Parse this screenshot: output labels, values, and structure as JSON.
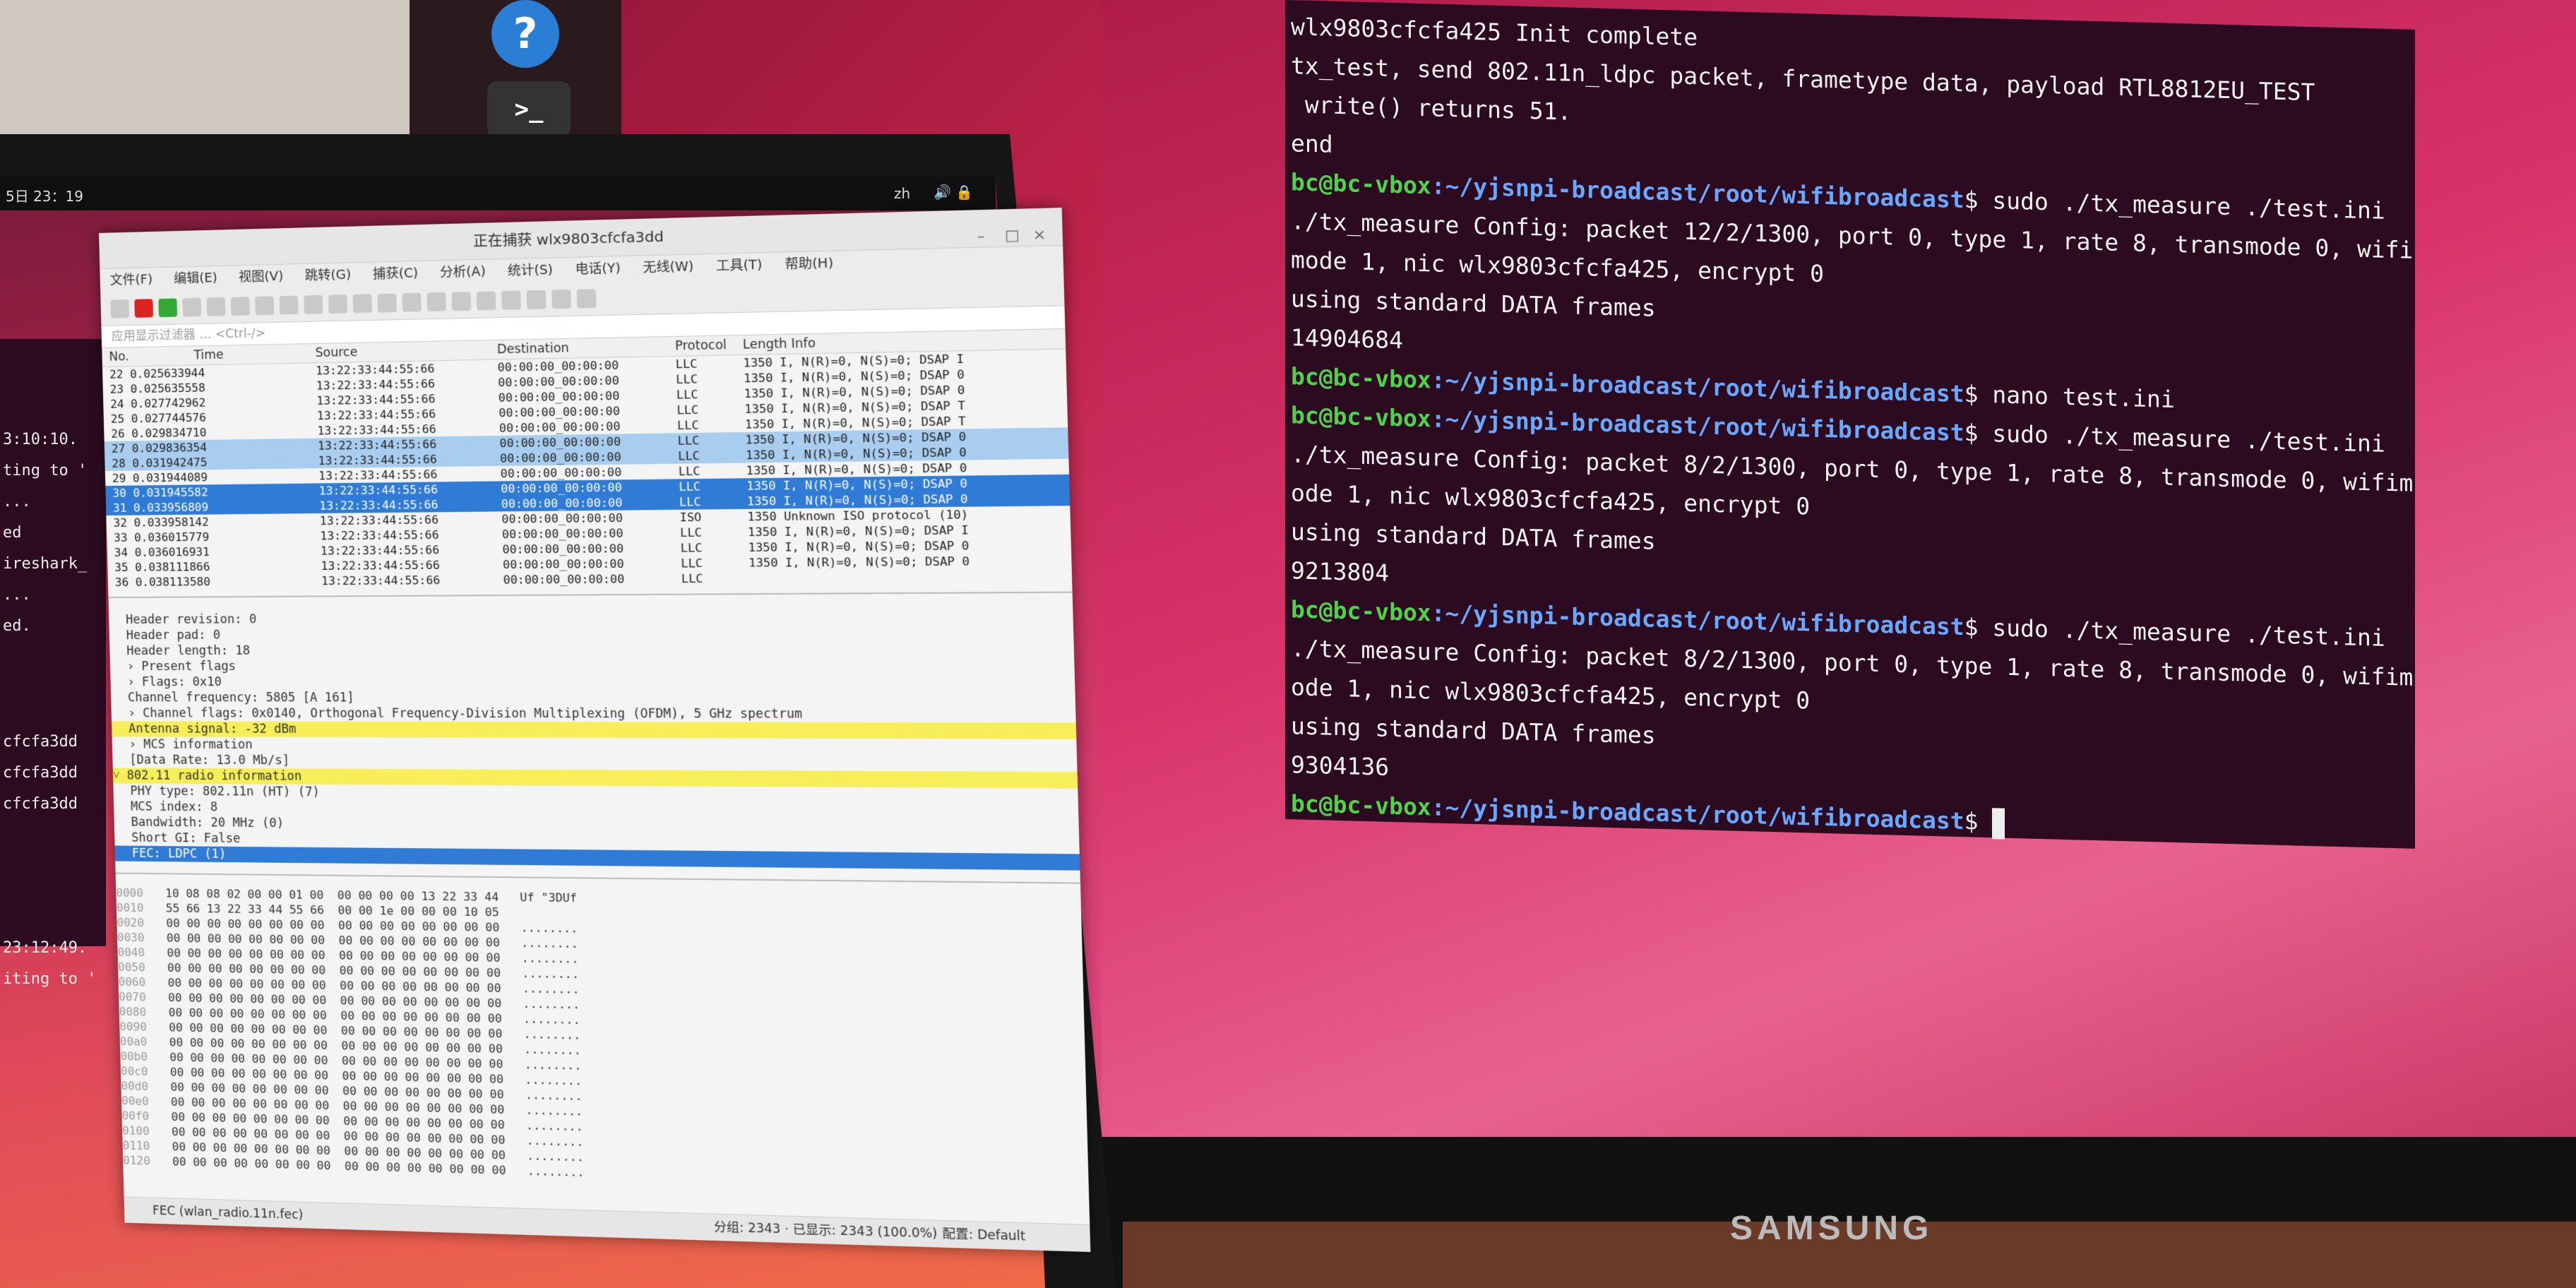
{
  "desktop": {
    "topbar_time": "5日 23：19",
    "topbar_lang": "zh",
    "topbar_indicators": "🔊 🔒"
  },
  "background_terminal": {
    "lines": [
      "3:10:10.",
      "ting to '",
      "...",
      "ed",
      "ireshark_",
      "...",
      "ed.",
      "cfcfa3dd",
      "cfcfa3dd",
      "cfcfa3dd",
      "23:12:49.",
      "iting to '"
    ]
  },
  "wireshark": {
    "title": "正在捕获 wlx9803cfcfa3dd",
    "menu": [
      "文件(F)",
      "编辑(E)",
      "视图(V)",
      "跳转(G)",
      "捕获(C)",
      "分析(A)",
      "统计(S)",
      "电话(Y)",
      "无线(W)",
      "工具(T)",
      "帮助(H)"
    ],
    "filter_placeholder": "应用显示过滤器 … <Ctrl-/>",
    "columns": [
      "No.",
      "Time",
      "Source",
      "Destination",
      "Protocol",
      "Length",
      "Info"
    ],
    "packets": [
      {
        "no": "22",
        "time": "0.025633944",
        "src": "13:22:33:44:55:66",
        "dst": "00:00:00_00:00:00",
        "proto": "LLC",
        "info": "1350 I, N(R)=0, N(S)=0; DSAP I"
      },
      {
        "no": "23",
        "time": "0.025635558",
        "src": "13:22:33:44:55:66",
        "dst": "00:00:00_00:00:00",
        "proto": "LLC",
        "info": "1350 I, N(R)=0, N(S)=0; DSAP 0"
      },
      {
        "no": "24",
        "time": "0.027742962",
        "src": "13:22:33:44:55:66",
        "dst": "00:00:00_00:00:00",
        "proto": "LLC",
        "info": "1350 I, N(R)=0, N(S)=0; DSAP 0"
      },
      {
        "no": "25",
        "time": "0.027744576",
        "src": "13:22:33:44:55:66",
        "dst": "00:00:00_00:00:00",
        "proto": "LLC",
        "info": "1350 I, N(R)=0, N(S)=0; DSAP T"
      },
      {
        "no": "26",
        "time": "0.029834710",
        "src": "13:22:33:44:55:66",
        "dst": "00:00:00_00:00:00",
        "proto": "LLC",
        "info": "1350 I, N(R)=0, N(S)=0; DSAP T"
      },
      {
        "no": "27",
        "time": "0.029836354",
        "src": "13:22:33:44:55:66",
        "dst": "00:00:00_00:00:00",
        "proto": "LLC",
        "info": "1350 I, N(R)=0, N(S)=0; DSAP 0"
      },
      {
        "no": "28",
        "time": "0.031942475",
        "src": "13:22:33:44:55:66",
        "dst": "00:00:00_00:00:00",
        "proto": "LLC",
        "info": "1350 I, N(R)=0, N(S)=0; DSAP 0"
      },
      {
        "no": "29",
        "time": "0.031944089",
        "src": "13:22:33:44:55:66",
        "dst": "00:00:00_00:00:00",
        "proto": "LLC",
        "info": "1350 I, N(R)=0, N(S)=0; DSAP 0"
      },
      {
        "no": "30",
        "time": "0.031945582",
        "src": "13:22:33:44:55:66",
        "dst": "00:00:00_00:00:00",
        "proto": "LLC",
        "info": "1350 I, N(R)=0, N(S)=0; DSAP 0"
      },
      {
        "no": "31",
        "time": "0.033956809",
        "src": "13:22:33:44:55:66",
        "dst": "00:00:00_00:00:00",
        "proto": "LLC",
        "info": "1350 I, N(R)=0, N(S)=0; DSAP 0"
      },
      {
        "no": "32",
        "time": "0.033958142",
        "src": "13:22:33:44:55:66",
        "dst": "00:00:00_00:00:00",
        "proto": "ISO",
        "info": "1350 Unknown ISO protocol (10)"
      },
      {
        "no": "33",
        "time": "0.036015779",
        "src": "13:22:33:44:55:66",
        "dst": "00:00:00_00:00:00",
        "proto": "LLC",
        "info": "1350 I, N(R)=0, N(S)=0; DSAP I"
      },
      {
        "no": "34",
        "time": "0.036016931",
        "src": "13:22:33:44:55:66",
        "dst": "00:00:00_00:00:00",
        "proto": "LLC",
        "info": "1350 I, N(R)=0, N(S)=0; DSAP 0"
      },
      {
        "no": "35",
        "time": "0.038111866",
        "src": "13:22:33:44:55:66",
        "dst": "00:00:00_00:00:00",
        "proto": "LLC",
        "info": "1350 I, N(R)=0, N(S)=0; DSAP 0"
      },
      {
        "no": "36",
        "time": "0.038113580",
        "src": "13:22:33:44:55:66",
        "dst": "00:00:00_00:00:00",
        "proto": "LLC",
        "info": ""
      }
    ],
    "details": [
      "Header revision: 0",
      "Header pad: 0",
      "Header length: 18",
      "› Present flags",
      "› Flags: 0x10",
      "Channel frequency: 5805 [A 161]",
      "› Channel flags: 0x0140, Orthogonal Frequency-Division Multiplexing (OFDM), 5 GHz spectrum",
      "Antenna signal: -32 dBm",
      "› MCS information",
      "[Data Rate: 13.0 Mb/s]",
      "˅ 802.11 radio information",
      "PHY type: 802.11n (HT) (7)",
      "MCS index: 8",
      "Bandwidth: 20 MHz (0)",
      "Short GI: False",
      "FEC: LDPC (1)"
    ],
    "hex_rows": [
      {
        "off": "0000",
        "hex": "10 08 08 02 00 00 01 00  00 00 00 00 13 22 33 44",
        "ascii": "Uf \"3DUf"
      },
      {
        "off": "0010",
        "hex": "55 66 13 22 33 44 55 66  00 00 1e 00 00 00 10 05",
        "ascii": ""
      },
      {
        "off": "0020",
        "hex": "00 00 00 00 00 00 00 00  00 00 00 00 00 00 00 00",
        "ascii": "........"
      },
      {
        "off": "0030",
        "hex": "00 00 00 00 00 00 00 00  00 00 00 00 00 00 00 00",
        "ascii": "........"
      },
      {
        "off": "0040",
        "hex": "00 00 00 00 00 00 00 00  00 00 00 00 00 00 00 00",
        "ascii": "........"
      },
      {
        "off": "0050",
        "hex": "00 00 00 00 00 00 00 00  00 00 00 00 00 00 00 00",
        "ascii": "........"
      },
      {
        "off": "0060",
        "hex": "00 00 00 00 00 00 00 00  00 00 00 00 00 00 00 00",
        "ascii": "........"
      },
      {
        "off": "0070",
        "hex": "00 00 00 00 00 00 00 00  00 00 00 00 00 00 00 00",
        "ascii": "........"
      },
      {
        "off": "0080",
        "hex": "00 00 00 00 00 00 00 00  00 00 00 00 00 00 00 00",
        "ascii": "........"
      },
      {
        "off": "0090",
        "hex": "00 00 00 00 00 00 00 00  00 00 00 00 00 00 00 00",
        "ascii": "........"
      },
      {
        "off": "00a0",
        "hex": "00 00 00 00 00 00 00 00  00 00 00 00 00 00 00 00",
        "ascii": "........"
      },
      {
        "off": "00b0",
        "hex": "00 00 00 00 00 00 00 00  00 00 00 00 00 00 00 00",
        "ascii": "........"
      },
      {
        "off": "00c0",
        "hex": "00 00 00 00 00 00 00 00  00 00 00 00 00 00 00 00",
        "ascii": "........"
      },
      {
        "off": "00d0",
        "hex": "00 00 00 00 00 00 00 00  00 00 00 00 00 00 00 00",
        "ascii": "........"
      },
      {
        "off": "00e0",
        "hex": "00 00 00 00 00 00 00 00  00 00 00 00 00 00 00 00",
        "ascii": "........"
      },
      {
        "off": "00f0",
        "hex": "00 00 00 00 00 00 00 00  00 00 00 00 00 00 00 00",
        "ascii": "........"
      },
      {
        "off": "0100",
        "hex": "00 00 00 00 00 00 00 00  00 00 00 00 00 00 00 00",
        "ascii": "........"
      },
      {
        "off": "0110",
        "hex": "00 00 00 00 00 00 00 00  00 00 00 00 00 00 00 00",
        "ascii": "........"
      },
      {
        "off": "0120",
        "hex": "00 00 00 00 00 00 00 00  00 00 00 00 00 00 00 00",
        "ascii": "........"
      }
    ],
    "status_left": "FEC (wlan_radio.11n.fec)",
    "status_mid": "分组: 2343 · 已显示: 2343 (100.0%)",
    "status_right": "配置: Default"
  },
  "terminal": {
    "prompt_user": "bc@bc-vbox",
    "prompt_path": ":~/yjsnpi-broadcast/root/wifibroadcast",
    "lines": [
      {
        "type": "out",
        "text": "wlx9803cfcfa425 Init complete"
      },
      {
        "type": "out",
        "text": "tx_test, send 802.11n_ldpc packet, frametype data, payload RTL8812EU_TEST"
      },
      {
        "type": "out",
        "text": " write() returns 51."
      },
      {
        "type": "out",
        "text": "end"
      },
      {
        "type": "cmd",
        "text": "$ sudo ./tx_measure ./test.ini"
      },
      {
        "type": "out",
        "text": "./tx_measure Config: packet 12/2/1300, port 0, type 1, rate 8, transmode 0, wifi"
      },
      {
        "type": "out",
        "text": "mode 1, nic wlx9803cfcfa425, encrypt 0"
      },
      {
        "type": "out",
        "text": "using standard DATA frames"
      },
      {
        "type": "out",
        "text": "14904684"
      },
      {
        "type": "cmd",
        "text": "$ nano test.ini"
      },
      {
        "type": "cmd",
        "text": "$ sudo ./tx_measure ./test.ini"
      },
      {
        "type": "out",
        "text": "./tx_measure Config: packet 8/2/1300, port 0, type 1, rate 8, transmode 0, wifim"
      },
      {
        "type": "out",
        "text": "ode 1, nic wlx9803cfcfa425, encrypt 0"
      },
      {
        "type": "out",
        "text": "using standard DATA frames"
      },
      {
        "type": "out",
        "text": "9213804"
      },
      {
        "type": "cmd",
        "text": "$ sudo ./tx_measure ./test.ini"
      },
      {
        "type": "out",
        "text": "./tx_measure Config: packet 8/2/1300, port 0, type 1, rate 8, transmode 0, wifim"
      },
      {
        "type": "out",
        "text": "ode 1, nic wlx9803cfcfa425, encrypt 0"
      },
      {
        "type": "out",
        "text": "using standard DATA frames"
      },
      {
        "type": "out",
        "text": "9304136"
      },
      {
        "type": "cmd",
        "text": "$ "
      }
    ]
  },
  "monitor": {
    "brand": "SAMSUNG"
  },
  "colors": {
    "prompt_user": "#4fd34a",
    "prompt_path": "#6aa8ff",
    "terminal_bg": "#2c0a20",
    "selection_blue": "#2f7bd6",
    "highlight_yellow": "#f6ef5a"
  }
}
